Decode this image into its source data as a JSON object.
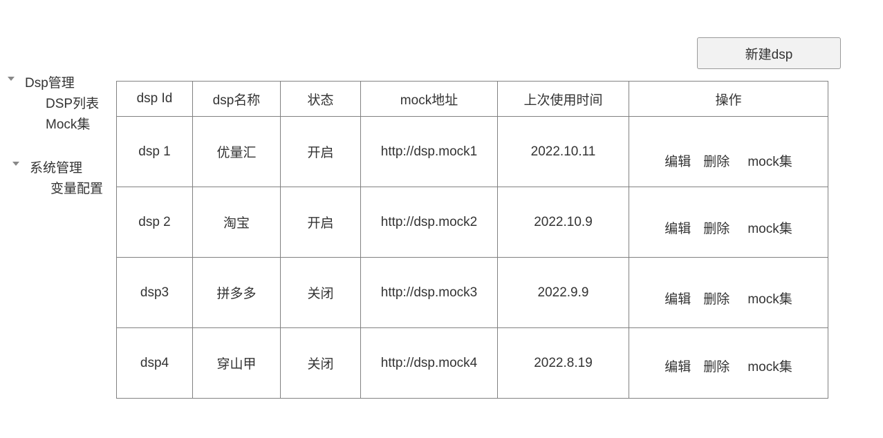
{
  "toolbar": {
    "new_button_label": "新建dsp"
  },
  "sidebar": {
    "groups": [
      {
        "label": "Dsp管理",
        "items": [
          "DSP列表",
          "Mock集"
        ]
      },
      {
        "label": "系统管理",
        "items": [
          "变量配置"
        ]
      }
    ]
  },
  "table": {
    "columns": [
      "dsp Id",
      "dsp名称",
      "状态",
      "mock地址",
      "上次使用时间",
      "操作"
    ],
    "rows": [
      {
        "id": "dsp 1",
        "name": "优量汇",
        "status": "开启",
        "mock_url": "http://dsp.mock1",
        "last_used": "2022.10.11"
      },
      {
        "id": "dsp 2",
        "name": "淘宝",
        "status": "开启",
        "mock_url": "http://dsp.mock2",
        "last_used": "2022.10.9"
      },
      {
        "id": "dsp3",
        "name": "拼多多",
        "status": "关闭",
        "mock_url": "http://dsp.mock3",
        "last_used": "2022.9.9"
      },
      {
        "id": "dsp4",
        "name": "穿山甲",
        "status": "关闭",
        "mock_url": "http://dsp.mock4",
        "last_used": "2022.8.19"
      }
    ],
    "actions": {
      "edit": "编辑",
      "delete": "删除",
      "mock": "mock集"
    }
  }
}
